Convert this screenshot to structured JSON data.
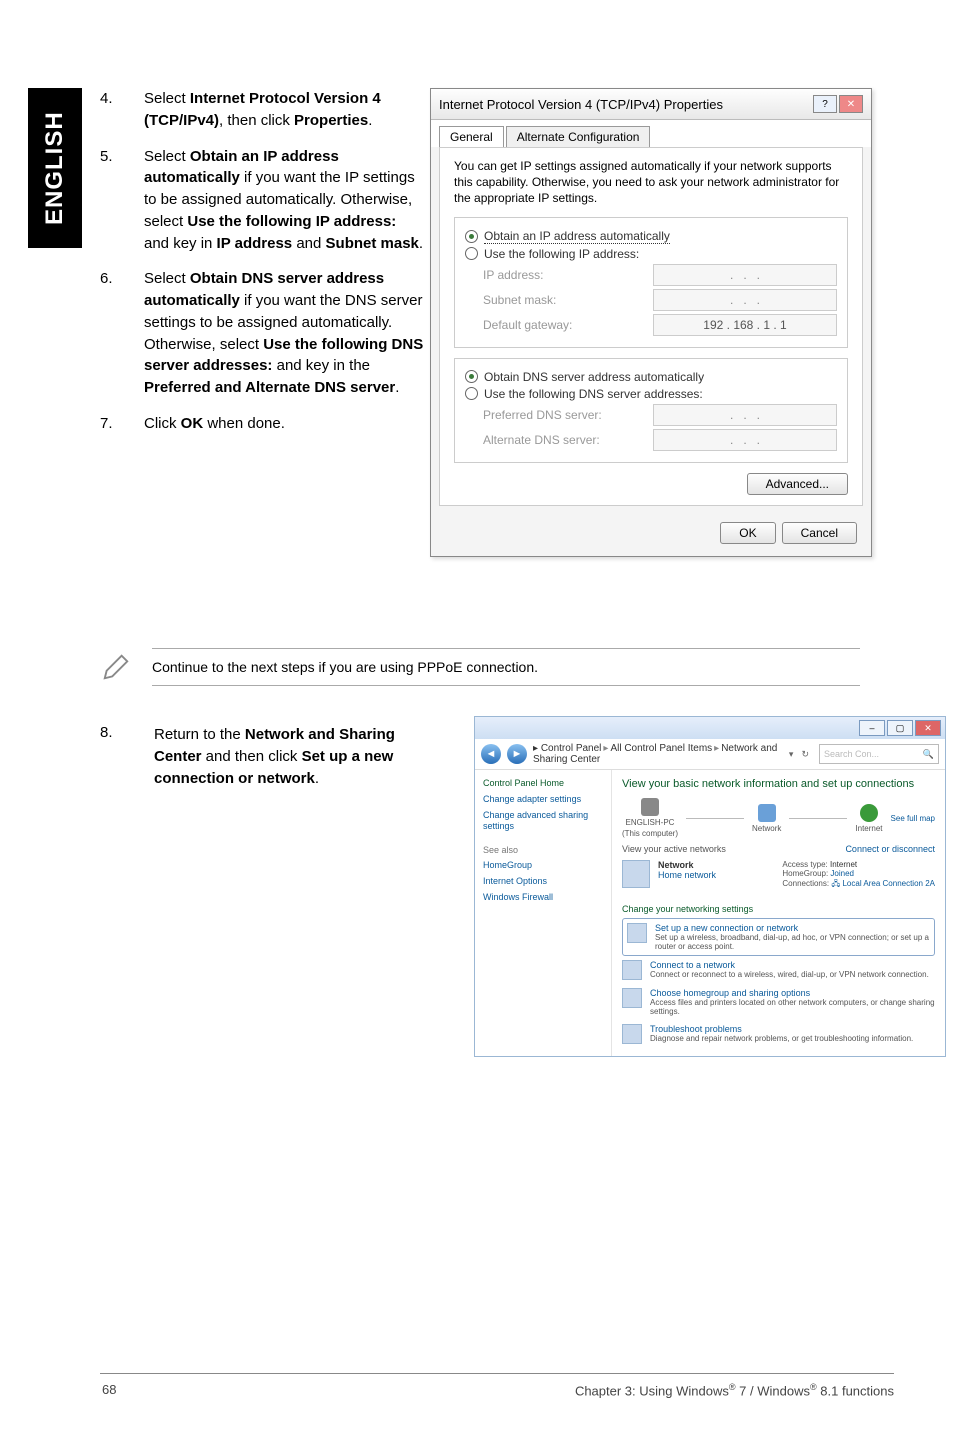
{
  "sideTab": "ENGLISH",
  "steps": {
    "s4": {
      "num": "4.",
      "text_a": "Select ",
      "b1": "Internet Protocol Version 4 (TCP/IPv4)",
      "text_b": ", then click ",
      "b2": "Properties",
      "text_c": "."
    },
    "s5": {
      "num": "5.",
      "text_a": "Select ",
      "b1": "Obtain an IP address automatically",
      "text_b": " if you want the IP settings to be assigned automatically. Otherwise, select ",
      "b2": "Use the following IP address:",
      "text_c": " and key in ",
      "b3": "IP address",
      "text_d": " and ",
      "b4": "Subnet mask",
      "text_e": "."
    },
    "s6": {
      "num": "6.",
      "text_a": "Select ",
      "b1": "Obtain DNS server address automatically",
      "text_b": " if you want the DNS server settings to be assigned automatically. Otherwise, select ",
      "b2": "Use the following DNS server addresses:",
      "text_c": " and key in the ",
      "b3": "Preferred and Alternate DNS server",
      "text_d": "."
    },
    "s7": {
      "num": "7.",
      "text_a": "Click ",
      "b1": "OK",
      "text_b": " when done."
    },
    "s8": {
      "num": "8.",
      "text_a": "Return to the ",
      "b1": "Network and Sharing Center",
      "text_b": " and then click ",
      "b2": "Set up a new connection or network",
      "text_c": "."
    }
  },
  "note": "Continue to the next steps if you are using PPPoE connection.",
  "dialog": {
    "title": "Internet Protocol Version 4 (TCP/IPv4) Properties",
    "tabs": {
      "general": "General",
      "alt": "Alternate Configuration"
    },
    "desc": "You can get IP settings assigned automatically if your network supports this capability. Otherwise, you need to ask your network administrator for the appropriate IP settings.",
    "r1": "Obtain an IP address automatically",
    "r2": "Use the following IP address:",
    "ip_lbl": "IP address:",
    "mask_lbl": "Subnet mask:",
    "gw_lbl": "Default gateway:",
    "gw_val": "192 . 168 .  1  .  1",
    "r3": "Obtain DNS server address automatically",
    "r4": "Use the following DNS server addresses:",
    "pref_lbl": "Preferred DNS server:",
    "alt_lbl": "Alternate DNS server:",
    "adv": "Advanced...",
    "ok": "OK",
    "cancel": "Cancel"
  },
  "win": {
    "bc1": "Control Panel",
    "bc2": "All Control Panel Items",
    "bc3": "Network and Sharing Center",
    "search_ph": "Search Con...",
    "sidebar": {
      "home": "Control Panel Home",
      "l1": "Change adapter settings",
      "l2": "Change advanced sharing settings",
      "see": "See also",
      "sa1": "HomeGroup",
      "sa2": "Internet Options",
      "sa3": "Windows Firewall"
    },
    "main": {
      "title": "View your basic network information and set up connections",
      "fullmap": "See full map",
      "node1": "ENGLISH-PC",
      "node1b": "(This computer)",
      "node2": "Network",
      "node3": "Internet",
      "view_net": "View your active networks",
      "conn_dc": "Connect or disconnect",
      "netname": "Network",
      "nettype": "Home network",
      "at_lbl": "Access type:",
      "at_val": "Internet",
      "hg_lbl": "HomeGroup:",
      "hg_val": "Joined",
      "cn_lbl": "Connections:",
      "cn_val": "Local Area Connection 2A",
      "chg": "Change your networking settings",
      "t1": "Set up a new connection or network",
      "t1d": "Set up a wireless, broadband, dial-up, ad hoc, or VPN connection; or set up a router or access point.",
      "t2": "Connect to a network",
      "t2d": "Connect or reconnect to a wireless, wired, dial-up, or VPN network connection.",
      "t3": "Choose homegroup and sharing options",
      "t3d": "Access files and printers located on other network computers, or change sharing settings.",
      "t4": "Troubleshoot problems",
      "t4d": "Diagnose and repair network problems, or get troubleshooting information."
    }
  },
  "footer": {
    "page": "68",
    "chapter_a": "Chapter 3: Using Windows",
    "reg": "®",
    "seven": " 7 / Windows",
    "eight": " 8.1 functions"
  }
}
